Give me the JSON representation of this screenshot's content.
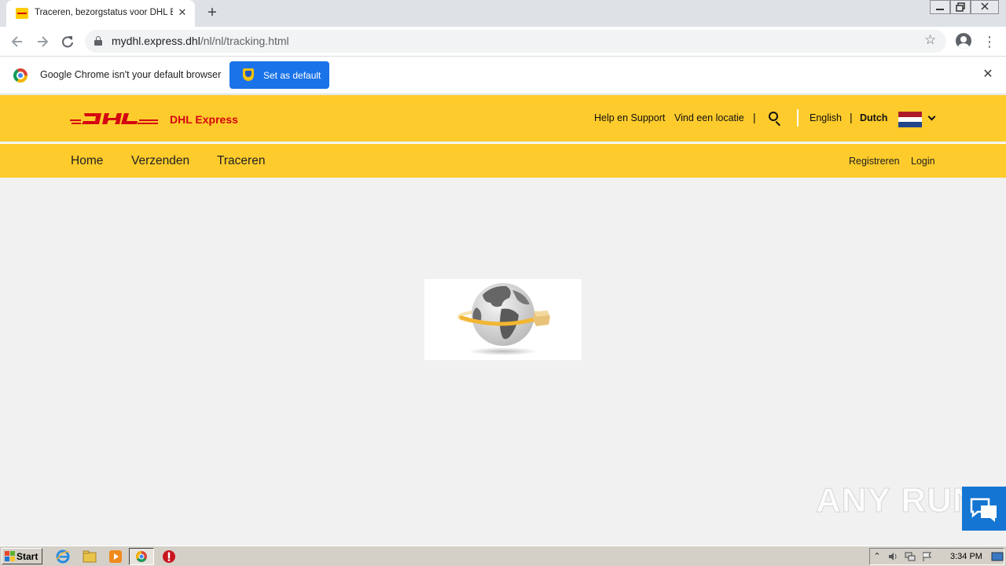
{
  "browser": {
    "tab": {
      "title": "Traceren, bezorgstatus voor DHL Ex",
      "close": "✕"
    },
    "new_tab": "+",
    "window_controls": [
      "minimize-icon",
      "restore-icon",
      "close-icon"
    ],
    "address": {
      "host": "mydhl.express.dhl",
      "path": "/nl/nl/tracking.html"
    }
  },
  "infobar": {
    "message": "Google Chrome isn't your default browser",
    "button": "Set as default",
    "close": "✕"
  },
  "dhl": {
    "brand": "DHL Express",
    "top_links": {
      "help": "Help en Support",
      "locate": "Vind een locatie",
      "english": "English",
      "dutch": "Dutch"
    },
    "separator": "|",
    "nav": {
      "home": "Home",
      "ship": "Verzenden",
      "track": "Traceren",
      "register": "Registreren",
      "login": "Login"
    },
    "colors": {
      "yellow": "#fdcb2c",
      "red": "#d40511"
    }
  },
  "overlay": {
    "watermark": "ANY RUN"
  },
  "taskbar": {
    "start": "Start",
    "pinned": [
      "internet-explorer-icon",
      "folder-icon",
      "media-player-icon",
      "chrome-icon",
      "stop-icon"
    ],
    "clock": "3:34 PM"
  }
}
